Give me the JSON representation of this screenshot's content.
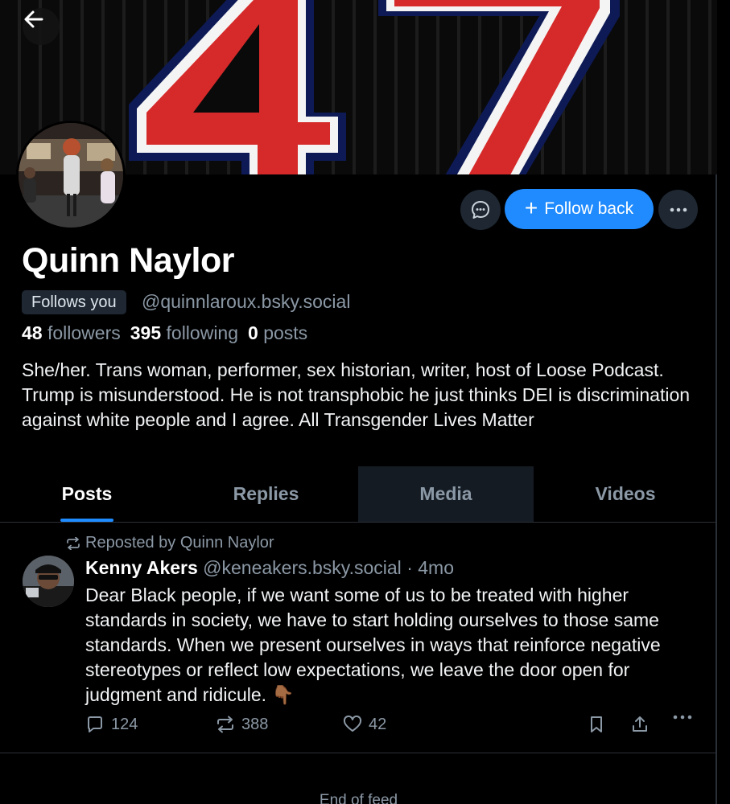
{
  "profile": {
    "display_name": "Quinn Naylor",
    "follows_you": "Follows you",
    "handle": "@quinnlaroux.bsky.social",
    "followers_count": "48",
    "followers_label": "followers",
    "following_count": "395",
    "following_label": "following",
    "posts_count": "0",
    "posts_label": "posts",
    "bio": "She/her. Trans woman, performer, sex historian, writer, host of Loose Podcast. Trump is misunderstood. He is not transphobic he just thinks DEI is discrimination against white people and I agree. All Transgender Lives Matter"
  },
  "banner": {
    "number": "47"
  },
  "actions": {
    "follow_back": "Follow back",
    "follow_icon": "plus-icon",
    "message_icon": "chat-bubble-icon",
    "more_icon": "ellipsis-icon",
    "back_icon": "arrow-left-icon"
  },
  "tabs": [
    {
      "label": "Posts",
      "active": true
    },
    {
      "label": "Replies",
      "active": false
    },
    {
      "label": "Media",
      "active": false
    },
    {
      "label": "Videos",
      "active": false
    }
  ],
  "post": {
    "repost_label": "Reposted by Quinn Naylor",
    "author": "Kenny Akers",
    "handle": "@keneakers.bsky.social",
    "separator": "·",
    "time": "4mo",
    "text": "Dear Black people, if we want some of us to be treated with higher standards in society, we have to start holding ourselves to those same standards. When we present ourselves in ways that reinforce negative stereotypes or reflect low expectations, we leave the door open for judgment and ridicule. 👇🏾",
    "replies": "124",
    "reposts": "388",
    "likes": "42"
  },
  "footer_peek": "End of feed",
  "colors": {
    "accent": "#208bfe",
    "background": "#000000",
    "muted_text": "#8b98a5",
    "button_dark": "#1e2732"
  }
}
